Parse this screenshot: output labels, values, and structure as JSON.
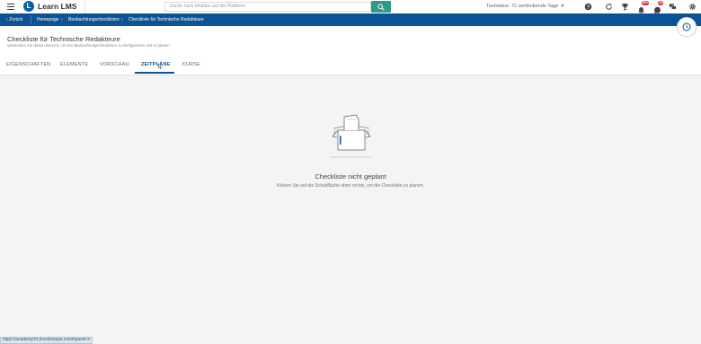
{
  "app": {
    "logo_letter": "L",
    "name": "Learn LMS",
    "search_placeholder": "Suche nach Inhalten auf der Plattform",
    "trial_status": "Teststatus: 72 verbleibende Tage",
    "badges": {
      "trophy": "",
      "notifications": "99+",
      "messages": "13"
    },
    "accent_color": "#0b5395",
    "search_button_color": "#2f9a8a"
  },
  "breadcrumb": {
    "back": "Zurück",
    "items": [
      "Homepage",
      "Beobachtungschecklisten",
      "Checkliste für Technische Redakteure"
    ]
  },
  "page": {
    "title": "Checkliste für Technische Redakteure",
    "subtitle": "Verwenden Sie diesen Bereich, um Ihre Beobachtungschecklisten zu konfigurieren und zu planen"
  },
  "tabs": [
    {
      "label": "EIGENSCHAFTEN",
      "active": false
    },
    {
      "label": "ELEMENTE",
      "active": false
    },
    {
      "label": "VORSCHAU",
      "active": false
    },
    {
      "label": "ZEITPLÄNE",
      "active": true
    },
    {
      "label": "KURSE",
      "active": false
    }
  ],
  "empty_state": {
    "title": "Checkliste nicht geplant",
    "text": "Klicken Sie auf die Schaltfläche oben rechts, um die Checkliste zu planen."
  },
  "status_url": "https://academy70.docebosaas.com/#panel-3"
}
